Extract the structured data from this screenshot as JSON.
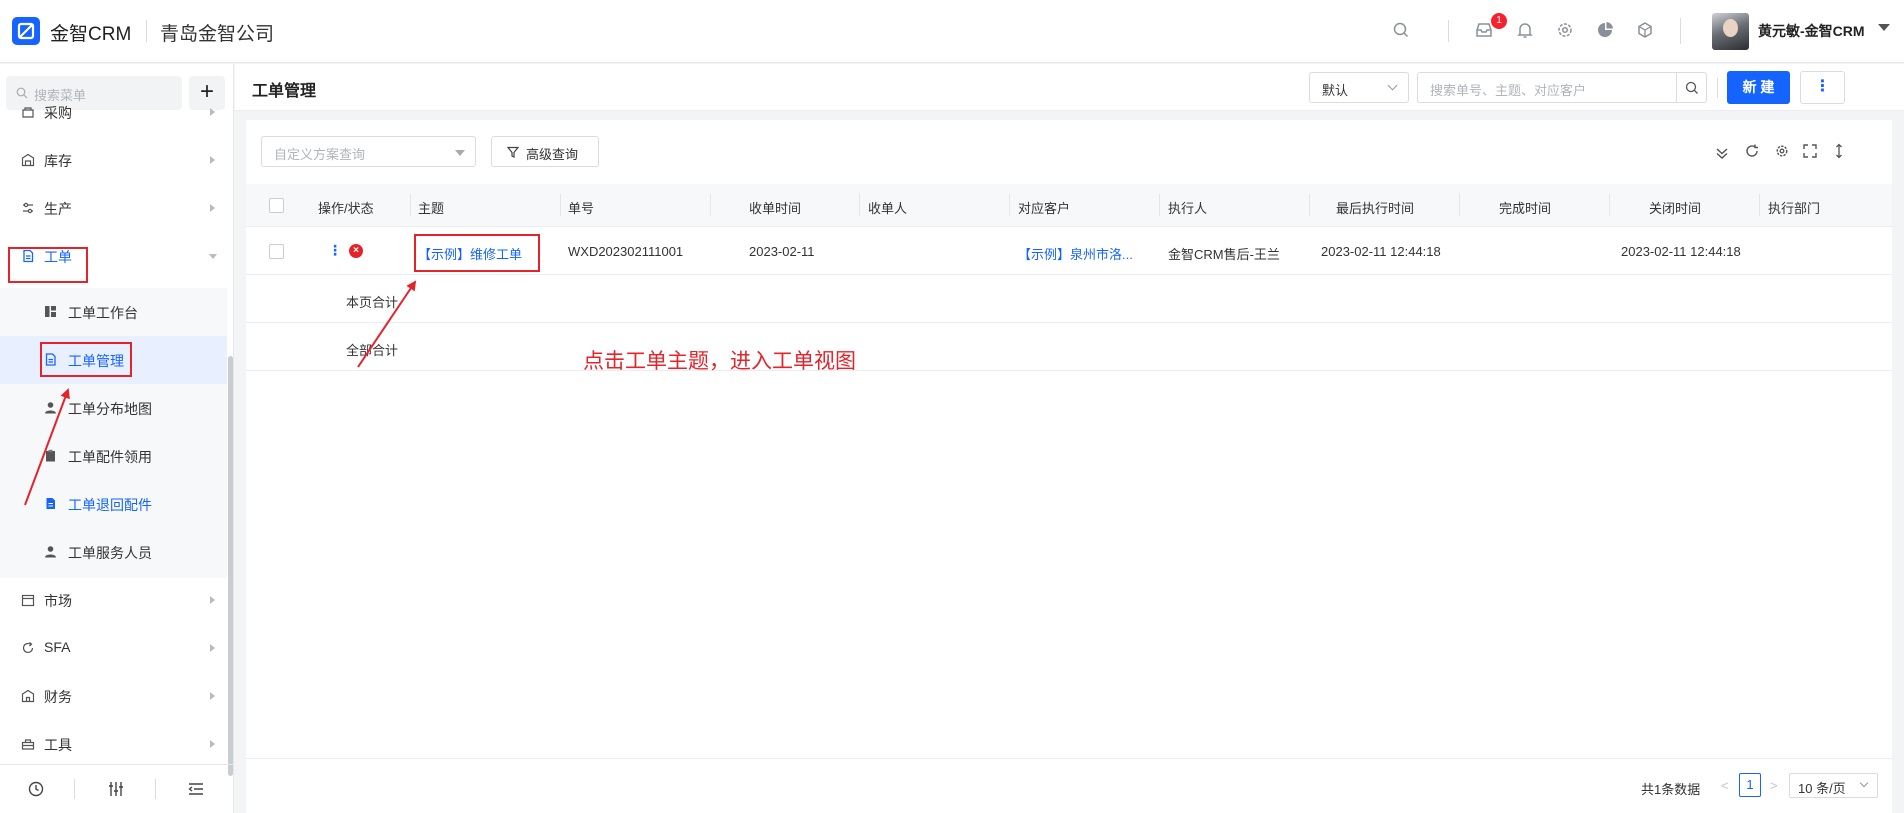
{
  "app": {
    "name": "金智CRM",
    "company": "青岛金智公司"
  },
  "topbar": {
    "notification_count": "1",
    "user_name": "黄元敏-金智CRM"
  },
  "sidebar": {
    "search_placeholder": "搜索菜单",
    "add_label": "+",
    "items": [
      {
        "label": "采购"
      },
      {
        "label": "库存"
      },
      {
        "label": "生产"
      },
      {
        "label": "工单"
      },
      {
        "label": "市场"
      },
      {
        "label": "SFA"
      },
      {
        "label": "财务"
      },
      {
        "label": "工具"
      }
    ],
    "workorder_children": [
      {
        "label": "工单工作台"
      },
      {
        "label": "工单管理"
      },
      {
        "label": "工单分布地图"
      },
      {
        "label": "工单配件领用"
      },
      {
        "label": "工单退回配件"
      },
      {
        "label": "工单服务人员"
      }
    ]
  },
  "header": {
    "title": "工单管理",
    "view_select": "默认",
    "search_placeholder": "搜索单号、主题、对应客户",
    "new_label": "新 建",
    "more_label": "⋮"
  },
  "filter": {
    "scheme_placeholder": "自定义方案查询",
    "advanced_label": "高级查询"
  },
  "table": {
    "columns": [
      "操作/状态",
      "主题",
      "单号",
      "收单时间",
      "收单人",
      "对应客户",
      "执行人",
      "最后执行时间",
      "完成时间",
      "关闭时间",
      "执行部门"
    ],
    "rows": [
      {
        "subject": "【示例】维修工单",
        "number": "WXD202302111001",
        "received_time": "2023-02-11",
        "receiver": "",
        "customer": "【示例】泉州市洛...",
        "executor": "金智CRM售后-王兰",
        "last_exec_time": "2023-02-11 12:44:18",
        "done_time": "",
        "close_time": "2023-02-11 12:44:18",
        "dept": ""
      }
    ],
    "page_total_label": "本页合计",
    "all_total_label": "全部合计"
  },
  "annotation": {
    "text": "点击工单主题，进入工单视图"
  },
  "pagination": {
    "total": "共1条数据",
    "current_page": "1",
    "page_size": "10 条/页"
  },
  "colors": {
    "brand": "#1664ff",
    "annotation": "#e3242b"
  }
}
